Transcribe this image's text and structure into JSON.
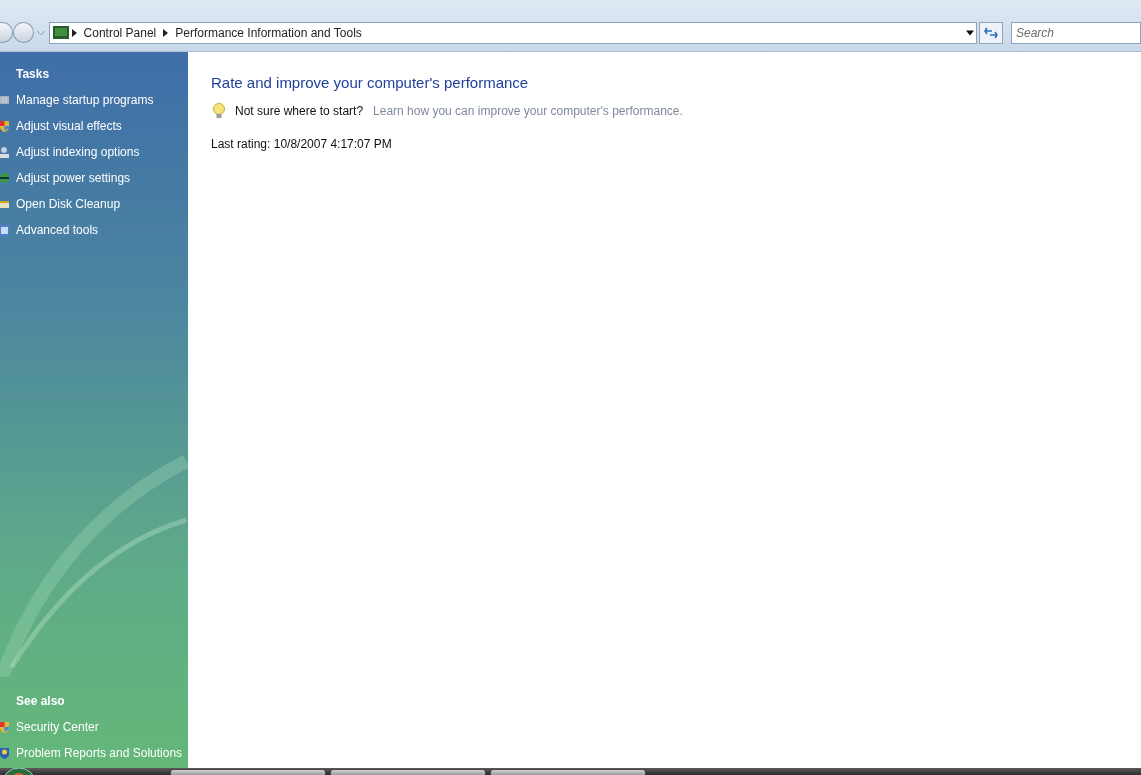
{
  "address_bar": {
    "breadcrumbs": [
      "Control Panel",
      "Performance Information and Tools"
    ]
  },
  "search": {
    "placeholder": "Search"
  },
  "sidebar": {
    "tasks_heading": "Tasks",
    "tasks": [
      {
        "label": "Manage startup programs",
        "kind": "startup"
      },
      {
        "label": "Adjust visual effects",
        "kind": "shield"
      },
      {
        "label": "Adjust indexing options",
        "kind": "indexing"
      },
      {
        "label": "Adjust power settings",
        "kind": "power"
      },
      {
        "label": "Open Disk Cleanup",
        "kind": "disk"
      },
      {
        "label": "Advanced tools",
        "kind": "tools"
      }
    ],
    "see_also_heading": "See also",
    "see_also": [
      {
        "label": "Security Center",
        "kind": "shield"
      },
      {
        "label": "Problem Reports and Solutions",
        "kind": "reports"
      }
    ]
  },
  "main": {
    "title": "Rate and improve your computer's performance",
    "tip_prompt": "Not sure where to start?",
    "tip_link": "Learn how you can improve your computer's performance.",
    "last_rating": "Last rating: 10/8/2007 4:17:07 PM"
  }
}
